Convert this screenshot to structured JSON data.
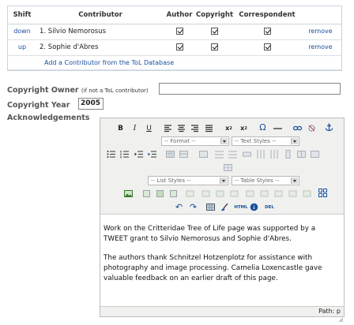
{
  "contributors": {
    "headers": {
      "shift": "Shift",
      "contributor": "Contributor",
      "author": "Author",
      "copyright": "Copyright",
      "correspondent": "Correspondent"
    },
    "rows": [
      {
        "shift": "down",
        "name": "1. Silvio Nemorosus",
        "author": true,
        "copyright": true,
        "correspondent": true,
        "remove": "remove"
      },
      {
        "shift": "up",
        "name": "2. Sophie d'Abres",
        "author": true,
        "copyright": true,
        "correspondent": true,
        "remove": "remove"
      }
    ],
    "add_link": "Add a Contributor from the ToL Database"
  },
  "copyright_owner": {
    "label": "Copyright Owner",
    "note": "(if not a ToL contributor)",
    "value": ""
  },
  "copyright_year": {
    "label": "Copyright Year",
    "value": "2005"
  },
  "acknowledgements": {
    "label": "Acknowledgements"
  },
  "editor": {
    "format_select": "-- Format --",
    "text_styles_select": "-- Text Styles --",
    "list_styles_select": "-- List Styles --",
    "table_styles_select": "-- Table Styles --",
    "html_label": "HTML",
    "del_label": "DEL",
    "paragraphs": [
      "Work on the Critteridae Tree of Life page was supported by a TWEET grant to Silvio Nemorosus and Sophie d'Abres.",
      "The authors thank Schnitzel Hotzenplotz for assistance with photography and image processing. Camelia Loxencastle gave valuable feedback on an earlier draft of this page."
    ],
    "path_text": "Path: p"
  }
}
